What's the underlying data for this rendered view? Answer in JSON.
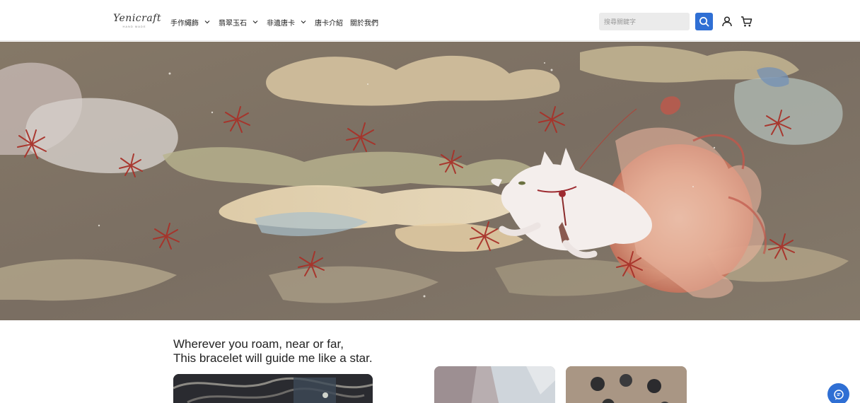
{
  "brand": {
    "logo_text": "Yenicraft",
    "logo_sub": "HAND MADE"
  },
  "nav": {
    "items": [
      {
        "label": "手作繩飾",
        "has_dropdown": true
      },
      {
        "label": "翡翠玉石",
        "has_dropdown": true
      },
      {
        "label": "非遺唐卡",
        "has_dropdown": true
      },
      {
        "label": "唐卡介紹",
        "has_dropdown": false
      },
      {
        "label": "關於我們",
        "has_dropdown": false
      }
    ]
  },
  "search": {
    "placeholder": "搜尋關鍵字",
    "value": ""
  },
  "icons": {
    "search": "search-icon",
    "user": "user-icon",
    "cart": "cart-icon",
    "chat": "chat-icon",
    "dropdown": "chevron-down-icon"
  },
  "hero": {
    "image": "illustration of a white nine-tailed fox running among swirling clouds and red spider lilies"
  },
  "intro": {
    "line1": "Wherever you roam, near or far,",
    "line2": "This bracelet will guide me like a star."
  },
  "colors": {
    "accent": "#2f6fd4",
    "hero_background": "#7d7062",
    "search_field": "#ebebeb"
  }
}
